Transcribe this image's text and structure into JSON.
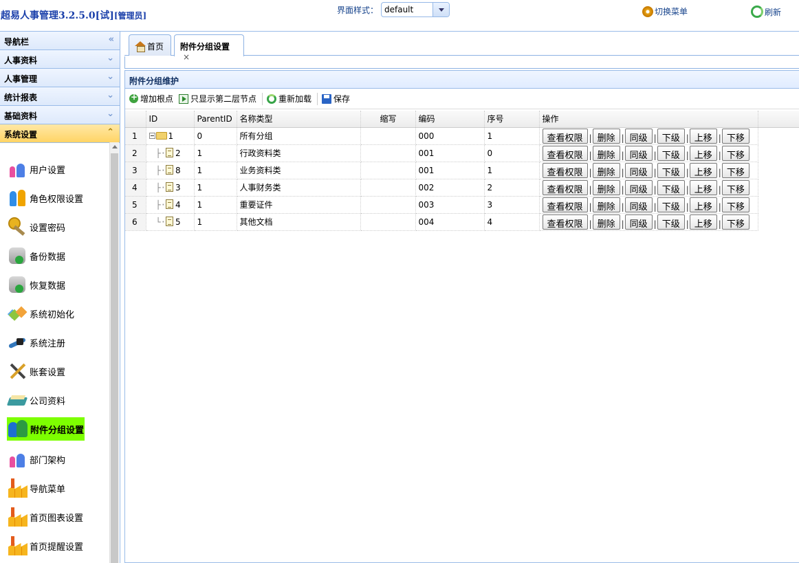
{
  "header": {
    "app_title": "超易人事管理3.2.5.0[试]",
    "role": "[管理员]",
    "style_label": "界面样式：",
    "style_value": "default",
    "switch_menu": "切换菜单",
    "refresh": "刷新"
  },
  "accordion": {
    "items": [
      {
        "label": "导航栏",
        "chevron": "«"
      },
      {
        "label": "人事资料",
        "chevron": "⌄"
      },
      {
        "label": "人事管理",
        "chevron": "⌄"
      },
      {
        "label": "统计报表",
        "chevron": "⌄"
      },
      {
        "label": "基础资料",
        "chevron": "⌄"
      },
      {
        "label": "系统设置",
        "chevron": "⌃"
      }
    ]
  },
  "nav": {
    "items": [
      {
        "label": "用户设置",
        "icon": "users-icon"
      },
      {
        "label": "角色权限设置",
        "icon": "roles-icon"
      },
      {
        "label": "设置密码",
        "icon": "key-icon"
      },
      {
        "label": "备份数据",
        "icon": "database-backup-icon"
      },
      {
        "label": "恢复数据",
        "icon": "database-restore-icon"
      },
      {
        "label": "系统初始化",
        "icon": "cubes-icon"
      },
      {
        "label": "系统注册",
        "icon": "drill-icon"
      },
      {
        "label": "账套设置",
        "icon": "tools-icon"
      },
      {
        "label": "公司资料",
        "icon": "book-icon"
      },
      {
        "label": "附件分组设置",
        "icon": "group-icon"
      },
      {
        "label": "部门架构",
        "icon": "org-icon"
      },
      {
        "label": "导航菜单",
        "icon": "factory-icon"
      },
      {
        "label": "首页图表设置",
        "icon": "factory-icon"
      },
      {
        "label": "首页提醒设置",
        "icon": "factory-icon"
      }
    ],
    "selected_index": 9
  },
  "tabs": [
    {
      "label": "首页"
    },
    {
      "label": "附件分组设置",
      "close": "×"
    }
  ],
  "panel": {
    "title": "附件分组维护",
    "toolbar": {
      "add_root": "增加根点",
      "show_second": "只显示第二层节点",
      "reload": "重新加载",
      "save": "保存"
    }
  },
  "grid": {
    "columns": [
      "ID",
      "ParentID",
      "名称类型",
      "缩写",
      "编码",
      "序号",
      "操作"
    ],
    "rows": [
      {
        "rn": "1",
        "id": "1",
        "parent": "0",
        "name": "所有分组",
        "abbr": "",
        "code": "000",
        "seq": "1"
      },
      {
        "rn": "2",
        "id": "2",
        "parent": "1",
        "name": "行政资料类",
        "abbr": "",
        "code": "001",
        "seq": "0"
      },
      {
        "rn": "3",
        "id": "8",
        "parent": "1",
        "name": "业务资料类",
        "abbr": "",
        "code": "001",
        "seq": "1"
      },
      {
        "rn": "4",
        "id": "3",
        "parent": "1",
        "name": "人事财务类",
        "abbr": "",
        "code": "002",
        "seq": "2"
      },
      {
        "rn": "5",
        "id": "4",
        "parent": "1",
        "name": "重要证件",
        "abbr": "",
        "code": "003",
        "seq": "3"
      },
      {
        "rn": "6",
        "id": "5",
        "parent": "1",
        "name": "其他文档",
        "abbr": "",
        "code": "004",
        "seq": "4"
      }
    ],
    "actions": [
      "查看权限",
      "删除",
      "同级",
      "下级",
      "上移",
      "下移"
    ]
  }
}
